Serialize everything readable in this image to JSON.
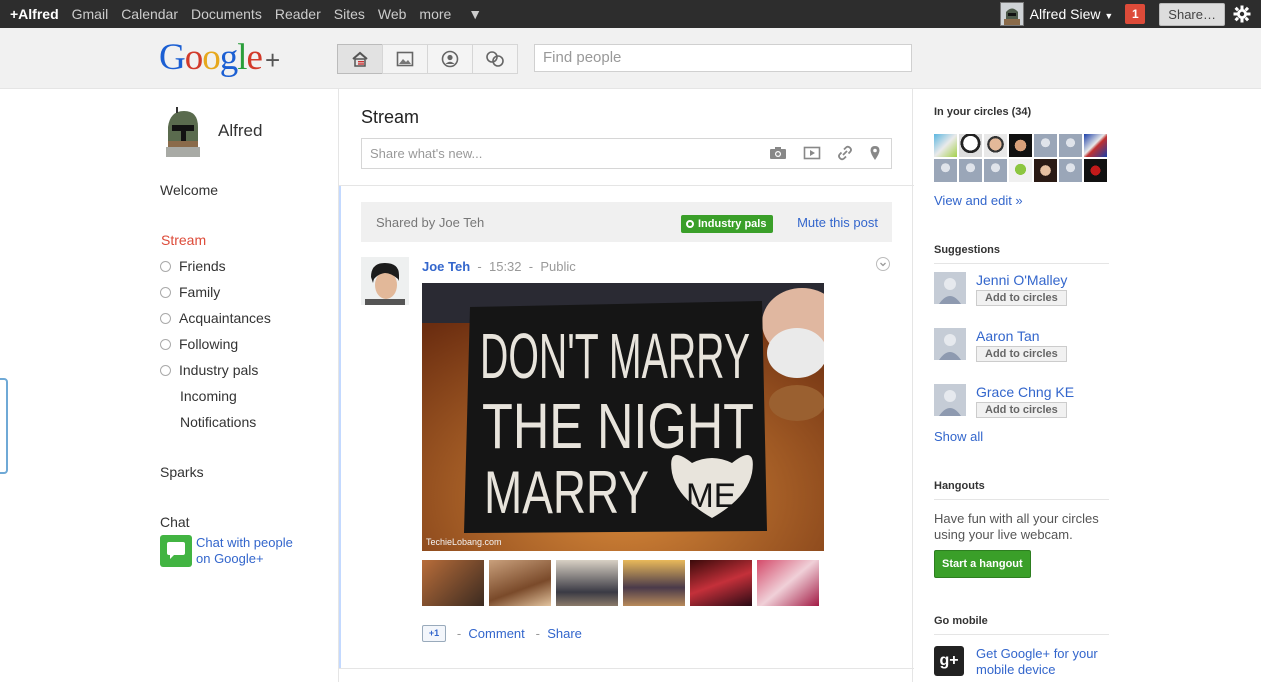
{
  "topbar": {
    "nav": [
      "+Alfred",
      "Gmail",
      "Calendar",
      "Documents",
      "Reader",
      "Sites",
      "Web",
      "more"
    ],
    "user_name": "Alfred Siew",
    "notification_count": "1",
    "share_label": "Share…"
  },
  "header": {
    "logo_text": "Google",
    "logo_plus": "+",
    "search_placeholder": "Find people",
    "mode_icons": [
      "home-stream-icon",
      "photos-icon",
      "profile-icon",
      "circles-icon"
    ]
  },
  "leftnav": {
    "profile_name": "Alfred",
    "welcome": "Welcome",
    "stream": "Stream",
    "circles": [
      "Friends",
      "Family",
      "Acquaintances",
      "Following",
      "Industry pals"
    ],
    "incoming": "Incoming",
    "notifications": "Notifications",
    "sparks": "Sparks",
    "chat_title": "Chat",
    "chat_line1": "Chat with people",
    "chat_line2": "on Google+"
  },
  "stream": {
    "title": "Stream",
    "share_placeholder": "Share what's new...",
    "post": {
      "shared_by": "Shared by Joe Teh",
      "circle_tag": "Industry pals",
      "mute_label": "Mute this post",
      "author": "Joe Teh",
      "time": "15:32",
      "visibility": "Public",
      "sep": "-",
      "photo_sign_lines": [
        "DON'T MARRY",
        "THE NIGHT",
        "MARRY ME"
      ],
      "watermark": "TechieLobang.com",
      "plus_one": "+1",
      "comment_label": "Comment",
      "share_label": "Share"
    }
  },
  "sidebar": {
    "circles_title": "In your circles (34)",
    "view_edit": "View and edit »",
    "suggestions_title": "Suggestions",
    "suggestions": [
      {
        "name": "Jenni O'Malley",
        "button": "Add to circles"
      },
      {
        "name": "Aaron Tan",
        "button": "Add to circles"
      },
      {
        "name": "Grace Chng KE",
        "button": "Add to circles"
      }
    ],
    "show_all": "Show all",
    "hangouts_title": "Hangouts",
    "hangouts_line1": "Have fun with all your circles",
    "hangouts_line2": "using your live webcam.",
    "hangout_button": "Start a hangout",
    "mobile_title": "Go mobile",
    "mobile_line1": "Get Google+ for your",
    "mobile_line2": "mobile device"
  }
}
